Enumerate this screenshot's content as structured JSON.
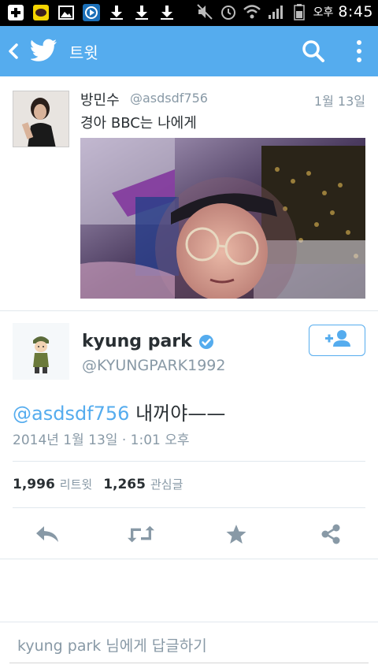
{
  "status_bar": {
    "ampm": "오후",
    "time": "8:45",
    "icons": [
      "add-icon",
      "kakaotalk-icon",
      "gallery-icon",
      "player-icon",
      "download-icon",
      "download-icon",
      "download-icon",
      "mute-icon",
      "alarm-icon",
      "wifi-icon",
      "signal-icon",
      "battery-icon"
    ]
  },
  "app_bar": {
    "title": "트윗",
    "icons": [
      "back-icon",
      "twitter-bird-icon",
      "search-icon",
      "more-vert-icon"
    ]
  },
  "quoted_tweet": {
    "name": "방민수",
    "handle": "@asdsdf756",
    "date": "1월 13일",
    "text": "경아 BBC는 나에게"
  },
  "tweet": {
    "name": "kyung park",
    "handle": "@KYUNGPARK1992",
    "mention": "@asdsdf756",
    "text": " 내꺼야——",
    "timestamp": "2014년 1월 13일 · 1:01 오후",
    "retweets": "1,996",
    "retweets_label": "리트윗",
    "favorites": "1,265",
    "favorites_label": "관심글"
  },
  "actions": [
    "reply-icon",
    "retweet-icon",
    "favorite-icon",
    "share-icon"
  ],
  "reply": {
    "placeholder": "kyung park 님에게 답글하기"
  },
  "colors": {
    "twitter_blue": "#55acee",
    "text": "#292f33",
    "secondary": "#8899a6",
    "icon_gray": "#8899a6"
  }
}
